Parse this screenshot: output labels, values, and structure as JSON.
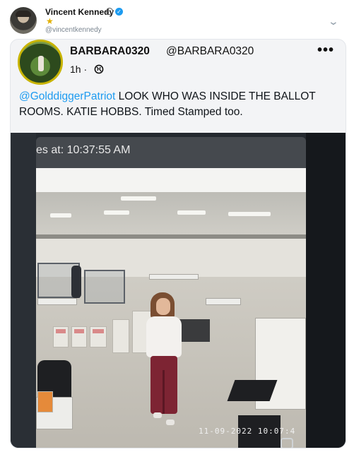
{
  "outer_post": {
    "display_name": "Vincent Kennedy",
    "handle": "@vincentkennedy",
    "icons": [
      "badge-icon",
      "verified-icon",
      "star-icon",
      "chevron-down-icon"
    ]
  },
  "quoted_post": {
    "display_name": "BARBARA0320",
    "handle": "@BARBARA0320",
    "time": "1h",
    "separator": "·",
    "more": "•••",
    "mention": "@GolddiggerPatriot",
    "text": " LOOK WHO WAS INSIDE THE BALLOT ROOMS. KATIE HOBBS. Timed Stamped too."
  },
  "media": {
    "timestamp_caption": "es at: 10:37:55 AM",
    "camera_timestamp": "11-09-2022 10:07:4",
    "description_icons": [
      "cctv-frame",
      "scroll-icon"
    ]
  },
  "colors": {
    "link": "#1d9bf0",
    "avatar_ring": "#c8b400",
    "card_bg": "#f3f4f6"
  }
}
